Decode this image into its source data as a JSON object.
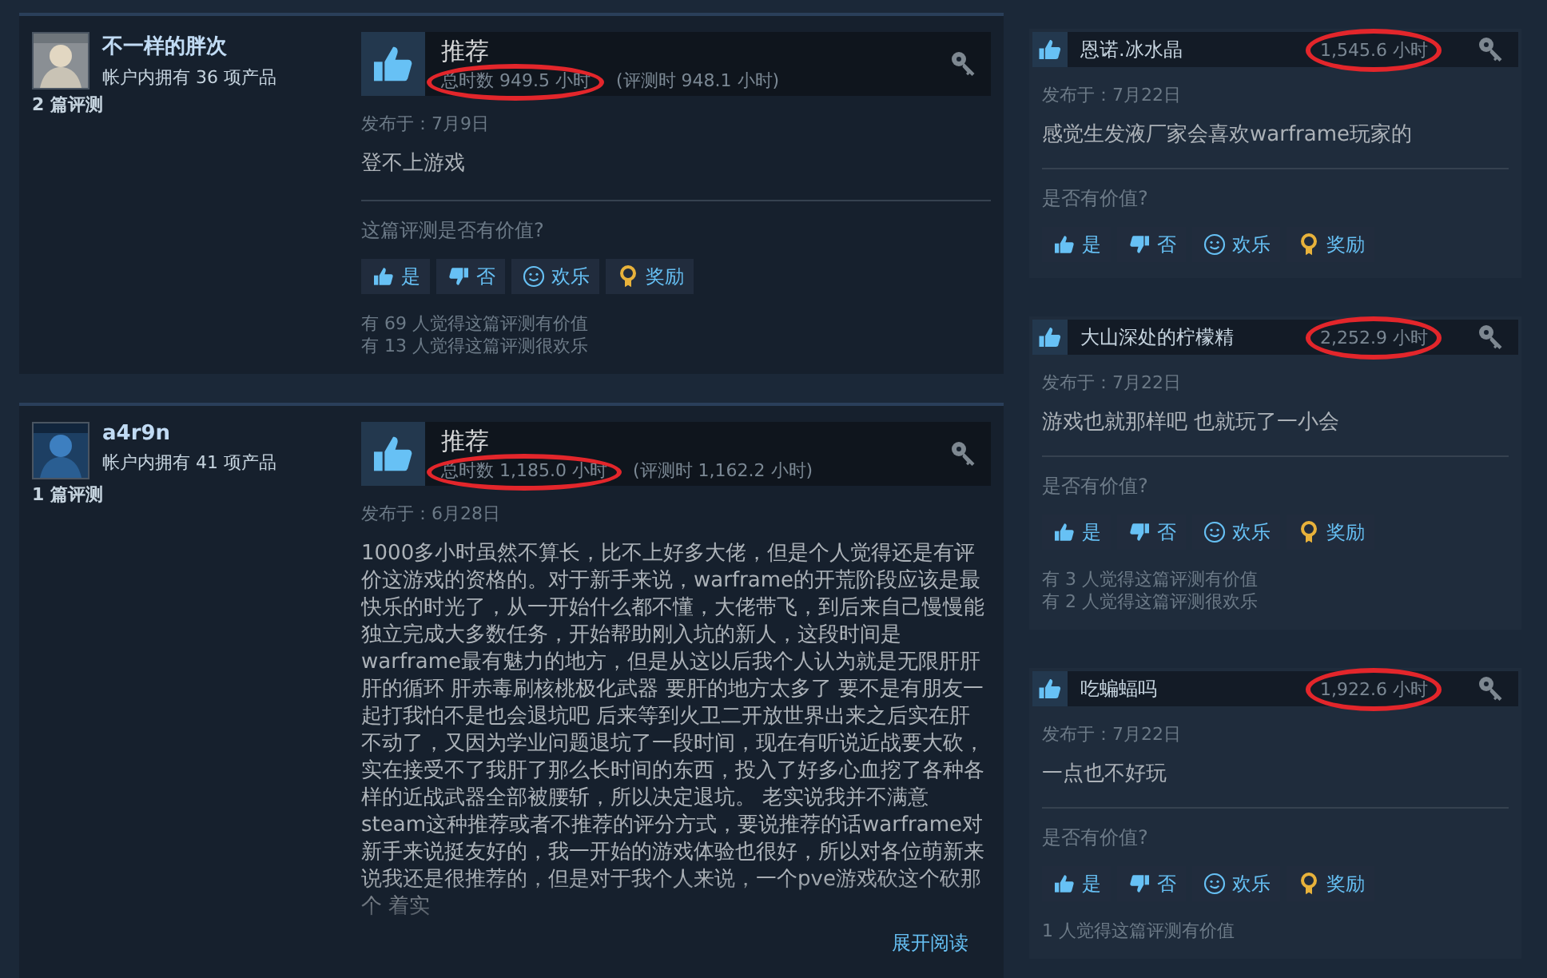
{
  "reviews": [
    {
      "author": "不一样的胖次",
      "products": "帐户内拥有 36 项产品",
      "review_count": "2 篇评测",
      "verdict": "推荐",
      "recommended": true,
      "total_hours": "总时数 949.5 小时",
      "hours_circled": true,
      "review_hours": "(评测时 948.1 小时)",
      "posted": "发布于：7月9日",
      "body": "登不上游戏",
      "helpful_prompt": "这篇评测是否有价值?",
      "buttons": [
        {
          "kind": "yes",
          "label": "是"
        },
        {
          "kind": "no",
          "label": "否"
        },
        {
          "kind": "funny",
          "label": "欢乐"
        },
        {
          "kind": "award",
          "label": "奖励"
        }
      ],
      "tallies": [
        "有 69 人觉得这篇评测有价值",
        "有 13 人觉得这篇评测很欢乐"
      ]
    },
    {
      "author": "a4r9n",
      "products": "帐户内拥有 41 项产品",
      "review_count": "1 篇评测",
      "verdict": "推荐",
      "recommended": true,
      "total_hours": "总时数 1,185.0 小时",
      "hours_circled": true,
      "review_hours": "(评测时 1,162.2 小时)",
      "posted": "发布于：6月28日",
      "body": "1000多小时虽然不算长，比不上好多大佬，但是个人觉得还是有评价这游戏的资格的。对于新手来说，warframe的开荒阶段应该是最快乐的时光了，从一开始什么都不懂，大佬带飞，到后来自己慢慢能独立完成大多数任务，开始帮助刚入坑的新人，这段时间是warframe最有魅力的地方，但是从这以后我个人认为就是无限肝肝肝的循环 肝赤毒刷核桃极化武器 要肝的地方太多了 要不是有朋友一起打我怕不是也会退坑吧 后来等到火卫二开放世界出来之后实在肝不动了，又因为学业问题退坑了一段时间，现在有听说近战要大砍，实在接受不了我肝了那么长时间的东西，投入了好多心血挖了各种各样的近战武器全部被腰斩，所以决定退坑。 老实说我并不满意steam这种推荐或者不推荐的评分方式，要说推荐的话warframe对新手来说挺友好的，我一开始的游戏体验也很好，所以对各位萌新来说我还是很推荐的，但是对于我个人来说，一个pve游戏砍这个砍那个 着实",
      "expand": "展开阅读"
    }
  ],
  "side_reviews": [
    {
      "author": "恩诺.冰水晶",
      "recommended": true,
      "hours": "1,545.6 小时",
      "hours_circled": true,
      "posted": "发布于：7月22日",
      "body": "感觉生发液厂家会喜欢warframe玩家的",
      "helpful_prompt": "是否有价值?",
      "buttons": [
        {
          "kind": "yes",
          "label": "是"
        },
        {
          "kind": "no",
          "label": "否"
        },
        {
          "kind": "funny",
          "label": "欢乐"
        },
        {
          "kind": "award",
          "label": "奖励"
        }
      ]
    },
    {
      "author": "大山深处的柠檬精",
      "recommended": true,
      "hours": "2,252.9 小时",
      "hours_circled": true,
      "posted": "发布于：7月22日",
      "body": "游戏也就那样吧 也就玩了一小会",
      "helpful_prompt": "是否有价值?",
      "buttons": [
        {
          "kind": "yes",
          "label": "是"
        },
        {
          "kind": "no",
          "label": "否"
        },
        {
          "kind": "funny",
          "label": "欢乐"
        },
        {
          "kind": "award",
          "label": "奖励"
        }
      ],
      "tallies": [
        "有 3 人觉得这篇评测有价值",
        "有 2 人觉得这篇评测很欢乐"
      ]
    },
    {
      "author": "吃蝙蝠吗",
      "recommended": true,
      "hours": "1,922.6 小时",
      "hours_circled": true,
      "posted": "发布于：7月22日",
      "body": "一点也不好玩",
      "helpful_prompt": "是否有价值?",
      "buttons": [
        {
          "kind": "yes",
          "label": "是"
        },
        {
          "kind": "no",
          "label": "否"
        },
        {
          "kind": "funny",
          "label": "欢乐"
        },
        {
          "kind": "award",
          "label": "奖励"
        }
      ],
      "tallies": [
        "1 人觉得这篇评测有价值"
      ]
    }
  ]
}
